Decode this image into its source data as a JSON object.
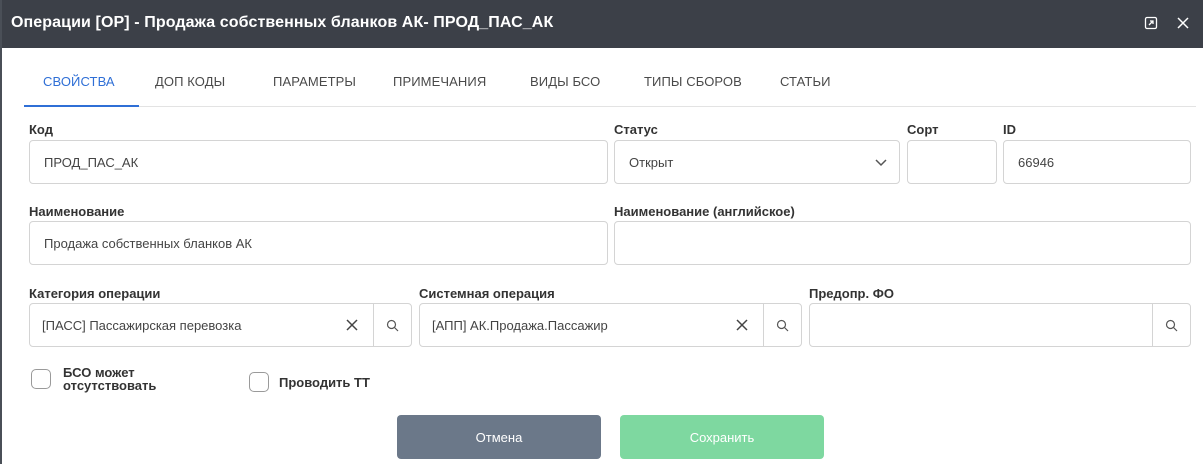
{
  "dialog": {
    "title": "Операции [OP] - Продажа собственных бланков АК- ПРОД_ПАС_АК"
  },
  "tabs": [
    {
      "label": "СВОЙСТВА",
      "active": true
    },
    {
      "label": "ДОП КОДЫ",
      "active": false
    },
    {
      "label": "ПАРАМЕТРЫ",
      "active": false
    },
    {
      "label": "ПРИМЕЧАНИЯ",
      "active": false
    },
    {
      "label": "ВИДЫ БСО",
      "active": false
    },
    {
      "label": "ТИПЫ СБОРОВ",
      "active": false
    },
    {
      "label": "СТАТЬИ",
      "active": false
    }
  ],
  "form": {
    "code": {
      "label": "Код",
      "value": "ПРОД_ПАС_АК"
    },
    "status": {
      "label": "Статус",
      "value": "Открыт"
    },
    "sort": {
      "label": "Сорт",
      "value": ""
    },
    "id": {
      "label": "ID",
      "value": "66946"
    },
    "name": {
      "label": "Наименование",
      "value": "Продажа собственных бланков АК"
    },
    "name_en": {
      "label": "Наименование (английское)",
      "value": ""
    },
    "op_category": {
      "label": "Категория операции",
      "value": "[ПАСС] Пассажирская перевозка"
    },
    "system_op": {
      "label": "Системная операция",
      "value": "[АПП] АК.Продажа.Пассажир"
    },
    "predef_fo": {
      "label": "Предопр. ФО",
      "value": ""
    },
    "bso_absent": {
      "label_line1": "БСО может",
      "label_line2": "отсутствовать",
      "checked": false
    },
    "conduct_tt": {
      "label": "Проводить ТТ",
      "checked": false
    }
  },
  "buttons": {
    "cancel": "Отмена",
    "save": "Сохранить"
  },
  "colors": {
    "titlebar": "#3c4048",
    "accent": "#2f6fd6",
    "cancel": "#6b7889",
    "save": "#7ed8a0"
  }
}
